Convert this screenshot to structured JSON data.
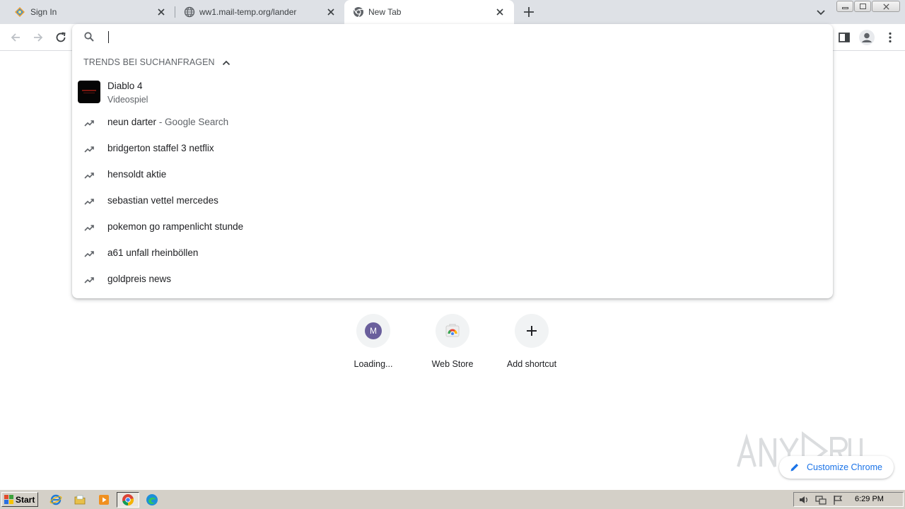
{
  "tabs": [
    {
      "title": "Sign In",
      "favicon": "sign-in-favicon",
      "close_glyph": "✕"
    },
    {
      "title": "ww1.mail-temp.org/lander",
      "favicon": "globe-icon",
      "close_glyph": "✕"
    },
    {
      "title": "New Tab",
      "favicon": "chrome-icon",
      "close_glyph": "✕",
      "active": true
    }
  ],
  "omnibox": {
    "value": "",
    "section_header": "TRENDS BEI SUCHANFRAGEN",
    "entity": {
      "title": "Diablo 4",
      "subtitle": "Videospiel"
    },
    "suggestions": [
      {
        "text": "neun darter",
        "description": " - Google Search"
      },
      {
        "text": "bridgerton staffel 3 netflix",
        "description": ""
      },
      {
        "text": "hensoldt aktie",
        "description": ""
      },
      {
        "text": "sebastian vettel mercedes",
        "description": ""
      },
      {
        "text": "pokemon go rampenlicht stunde",
        "description": ""
      },
      {
        "text": "a61 unfall rheinböllen",
        "description": ""
      },
      {
        "text": "goldpreis news",
        "description": ""
      }
    ]
  },
  "shortcuts": [
    {
      "label": "Loading...",
      "letter": "M"
    },
    {
      "label": "Web Store"
    },
    {
      "label": "Add shortcut"
    }
  ],
  "customize": {
    "label": "Customize Chrome"
  },
  "taskbar": {
    "start_label": "Start",
    "clock": "6:29 PM"
  },
  "colors": {
    "accent": "#1a73e8",
    "tabstrip": "#dee1e6",
    "taskbar": "#d4d0c8"
  }
}
